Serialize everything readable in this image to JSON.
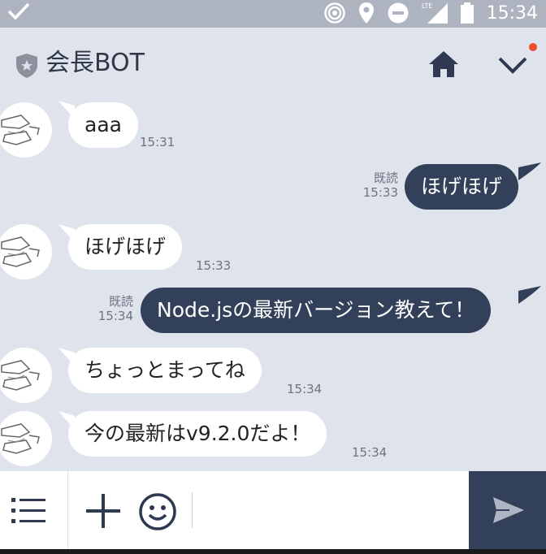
{
  "status_bar": {
    "time": "15:34",
    "network": "LTE"
  },
  "header": {
    "title": "会長BOT"
  },
  "messages": [
    {
      "side": "in",
      "text": "aaa",
      "time": "15:31",
      "read": ""
    },
    {
      "side": "out",
      "text": "ほげほげ",
      "time": "15:33",
      "read": "既読"
    },
    {
      "side": "in",
      "text": "ほげほげ",
      "time": "15:33",
      "read": ""
    },
    {
      "side": "out",
      "text": "Node.jsの最新バージョン教えて！",
      "time": "15:34",
      "read": "既読"
    },
    {
      "side": "in",
      "text": "ちょっとまってね",
      "time": "15:34",
      "read": ""
    },
    {
      "side": "in",
      "text": "今の最新はv9.2.0だよ！",
      "time": "15:34",
      "read": ""
    }
  ],
  "input": {
    "value": "",
    "placeholder": ""
  },
  "colors": {
    "accent": "#33405a",
    "background": "#dfe3ec",
    "notification_dot": "#f04c2b"
  }
}
